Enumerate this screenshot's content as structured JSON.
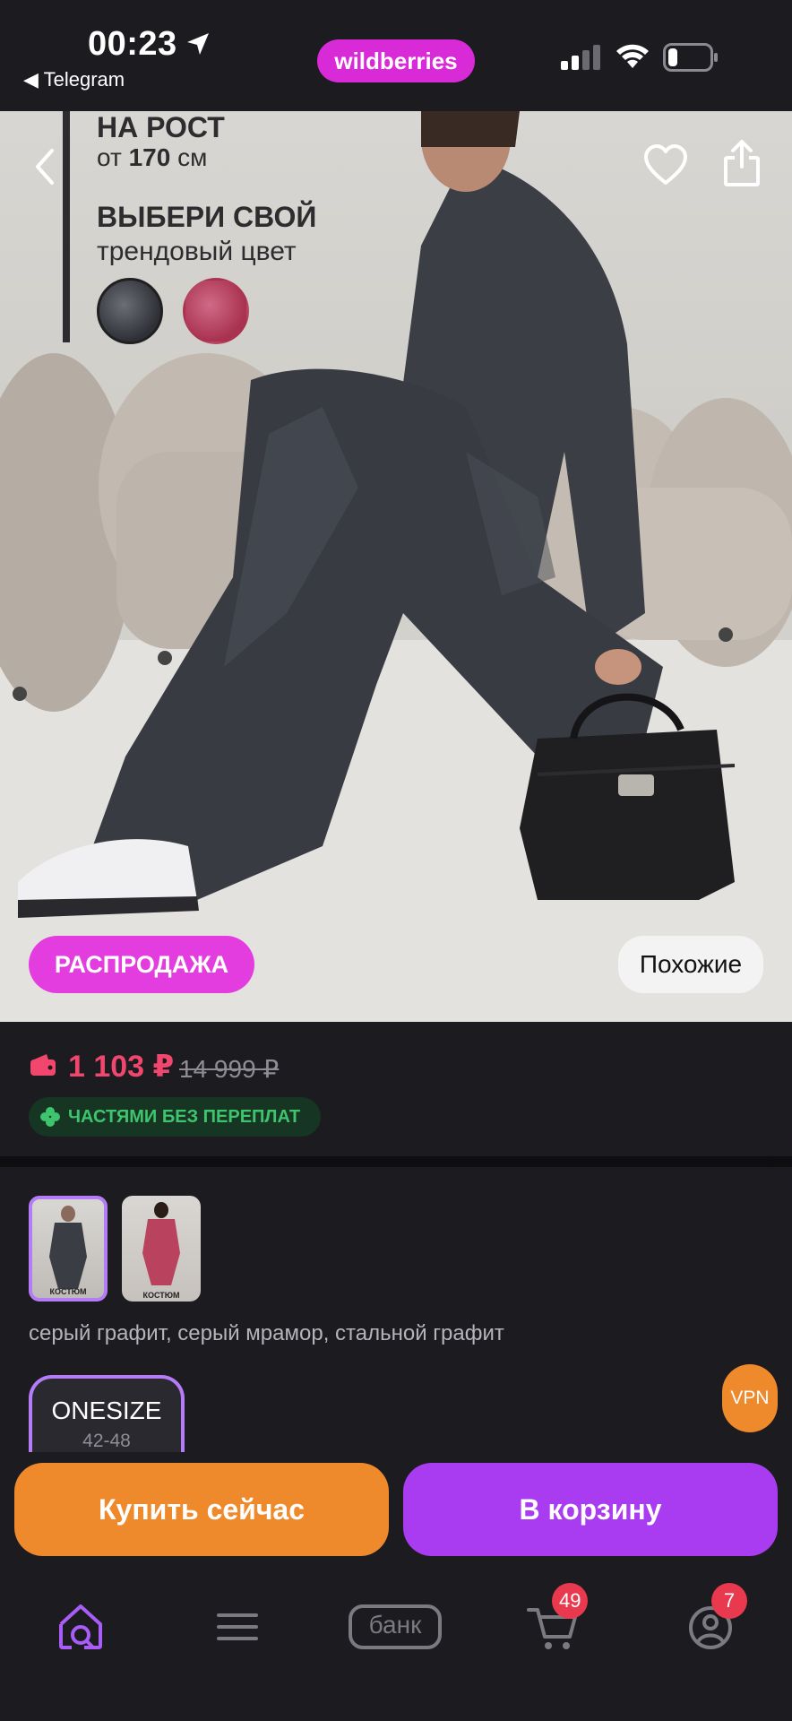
{
  "status_bar": {
    "time": "00:23",
    "back_app": "◀ Telegram",
    "brand": "wildberries"
  },
  "hero": {
    "promo_line1": "НА РОСТ",
    "promo_line2_prefix": "от",
    "promo_line2_value": "170",
    "promo_line2_unit": "см",
    "promo_line3": "ВЫБЕРИ СВОЙ",
    "promo_line4": "трендовый цвет",
    "sale_label": "РАСПРОДАЖА",
    "similar_label": "Похожие"
  },
  "price": {
    "current": "1 103 ₽",
    "old": "14 999 ₽",
    "installment": "ЧАСТЯМИ БЕЗ ПЕРЕПЛАТ"
  },
  "variants": {
    "thumb_caption": "КОСТЮМ",
    "colors_text": "серый графит, серый мрамор, стальной графит",
    "size_main": "ONESIZE",
    "size_sub": "42-48"
  },
  "vpn_label": "VPN",
  "actions": {
    "buy_now": "Купить сейчас",
    "to_cart": "В корзину"
  },
  "tabbar": {
    "bank_label": "банк",
    "cart_badge": "49",
    "profile_badge": "7"
  },
  "colors": {
    "brand": "#d92ad8",
    "sale": "#e33de0",
    "price": "#f1466d",
    "installment_text": "#3ec46d",
    "buy_now": "#ef8a2c",
    "to_cart": "#a93cf0",
    "accent_outline": "#b57cf7"
  }
}
